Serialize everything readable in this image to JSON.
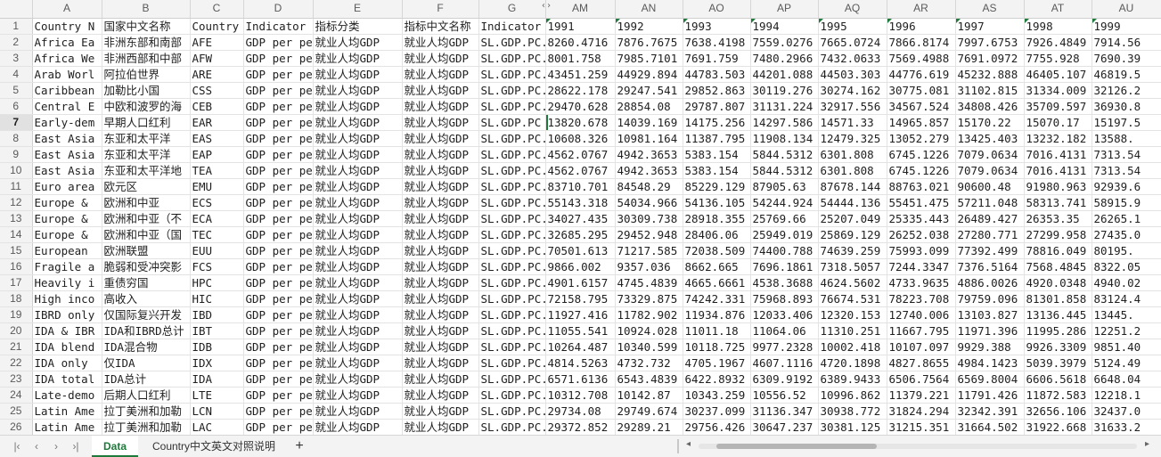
{
  "columns": [
    "",
    "A",
    "B",
    "C",
    "D",
    "E",
    "F",
    "G",
    "AM",
    "AN",
    "AO",
    "AP",
    "AQ",
    "AR",
    "AS",
    "AT",
    "AU"
  ],
  "header_row": {
    "num": "1",
    "cells": [
      "Country N",
      "国家中文名称",
      "Country",
      "Indicator",
      "指标分类",
      "指标中文名称",
      "Indicator",
      "1991",
      "1992",
      "1993",
      "1994",
      "1995",
      "1996",
      "1997",
      "1998",
      "1999"
    ]
  },
  "rows": [
    {
      "num": "2",
      "cells": [
        "Africa Ea",
        "非洲东部和南部",
        "AFE",
        "GDP per pe",
        "就业人均GDP",
        "就业人均GDP",
        "SL.GDP.PC.",
        "8260.4716",
        "7876.7675",
        "7638.4198",
        "7559.0276",
        "7665.0724",
        "7866.8174",
        "7997.6753",
        "7926.4849",
        "7914.56"
      ]
    },
    {
      "num": "3",
      "cells": [
        "Africa We",
        "非洲西部和中部",
        "AFW",
        "GDP per pe",
        "就业人均GDP",
        "就业人均GDP",
        "SL.GDP.PC.",
        "8001.758",
        "7985.7101",
        "7691.759",
        "7480.2966",
        "7432.0633",
        "7569.4988",
        "7691.0972",
        "7755.928",
        "7690.39"
      ]
    },
    {
      "num": "4",
      "cells": [
        "Arab Worl",
        "阿拉伯世界",
        "ARE",
        "GDP per pe",
        "就业人均GDP",
        "就业人均GDP",
        "SL.GDP.PC.",
        "43451.259",
        "44929.894",
        "44783.503",
        "44201.088",
        "44503.303",
        "44776.619",
        "45232.888",
        "46405.107",
        "46819.5"
      ]
    },
    {
      "num": "5",
      "cells": [
        "Caribbean",
        "加勒比小国",
        "CSS",
        "GDP per pe",
        "就业人均GDP",
        "就业人均GDP",
        "SL.GDP.PC.",
        "28622.178",
        "29247.541",
        "29852.863",
        "30119.276",
        "30274.162",
        "30775.081",
        "31102.815",
        "31334.009",
        "32126.2"
      ]
    },
    {
      "num": "6",
      "cells": [
        "Central E",
        "中欧和波罗的海",
        "CEB",
        "GDP per pe",
        "就业人均GDP",
        "就业人均GDP",
        "SL.GDP.PC.",
        "29470.628",
        "28854.08",
        "29787.807",
        "31131.224",
        "32917.556",
        "34567.524",
        "34808.426",
        "35709.597",
        "36930.8"
      ]
    },
    {
      "num": "7",
      "cells": [
        "Early-dem",
        "早期人口红利",
        "EAR",
        "GDP per pe",
        "就业人均GDP",
        "就业人均GDP",
        "SL.GDP.PC",
        "13820.678",
        "14039.169",
        "14175.256",
        "14297.586",
        "14571.33",
        "14965.857",
        "15170.22",
        "15070.17",
        "15197.5"
      ]
    },
    {
      "num": "8",
      "cells": [
        "East Asia",
        "东亚和太平洋",
        "EAS",
        "GDP per pe",
        "就业人均GDP",
        "就业人均GDP",
        "SL.GDP.PC.",
        "10608.326",
        "10981.164",
        "11387.795",
        "11908.134",
        "12479.325",
        "13052.279",
        "13425.403",
        "13232.182",
        "13588."
      ]
    },
    {
      "num": "9",
      "cells": [
        "East Asia",
        "东亚和太平洋",
        "EAP",
        "GDP per pe",
        "就业人均GDP",
        "就业人均GDP",
        "SL.GDP.PC.",
        "4562.0767",
        "4942.3653",
        "5383.154",
        "5844.5312",
        "6301.808",
        "6745.1226",
        "7079.0634",
        "7016.4131",
        "7313.54"
      ]
    },
    {
      "num": "10",
      "cells": [
        "East Asia",
        "东亚和太平洋地",
        "TEA",
        "GDP per pe",
        "就业人均GDP",
        "就业人均GDP",
        "SL.GDP.PC.",
        "4562.0767",
        "4942.3653",
        "5383.154",
        "5844.5312",
        "6301.808",
        "6745.1226",
        "7079.0634",
        "7016.4131",
        "7313.54"
      ]
    },
    {
      "num": "11",
      "cells": [
        "Euro area",
        "欧元区",
        "EMU",
        "GDP per pe",
        "就业人均GDP",
        "就业人均GDP",
        "SL.GDP.PC.",
        "83710.701",
        "84548.29",
        "85229.129",
        "87905.63",
        "87678.144",
        "88763.021",
        "90600.48",
        "91980.963",
        "92939.6"
      ]
    },
    {
      "num": "12",
      "cells": [
        "Europe &",
        "欧洲和中亚",
        "ECS",
        "GDP per pe",
        "就业人均GDP",
        "就业人均GDP",
        "SL.GDP.PC.",
        "55143.318",
        "54034.966",
        "54136.105",
        "54244.924",
        "54444.136",
        "55451.475",
        "57211.048",
        "58313.741",
        "58915.9"
      ]
    },
    {
      "num": "13",
      "cells": [
        "Europe &",
        "欧洲和中亚（不",
        "ECA",
        "GDP per pe",
        "就业人均GDP",
        "就业人均GDP",
        "SL.GDP.PC.",
        "34027.435",
        "30309.738",
        "28918.355",
        "25769.66",
        "25207.049",
        "25335.443",
        "26489.427",
        "26353.35",
        "26265.1"
      ]
    },
    {
      "num": "14",
      "cells": [
        "Europe &",
        "欧洲和中亚（国",
        "TEC",
        "GDP per pe",
        "就业人均GDP",
        "就业人均GDP",
        "SL.GDP.PC.",
        "32685.295",
        "29452.948",
        "28406.06",
        "25949.019",
        "25869.129",
        "26252.038",
        "27280.771",
        "27299.958",
        "27435.0"
      ]
    },
    {
      "num": "15",
      "cells": [
        "European",
        "欧洲联盟",
        "EUU",
        "GDP per pe",
        "就业人均GDP",
        "就业人均GDP",
        "SL.GDP.PC.",
        "70501.613",
        "71217.585",
        "72038.509",
        "74400.788",
        "74639.259",
        "75993.099",
        "77392.499",
        "78816.049",
        "80195."
      ]
    },
    {
      "num": "16",
      "cells": [
        "Fragile a",
        "脆弱和受冲突影",
        "FCS",
        "GDP per pe",
        "就业人均GDP",
        "就业人均GDP",
        "SL.GDP.PC.",
        "9866.002",
        "9357.036",
        "8662.665",
        "7696.1861",
        "7318.5057",
        "7244.3347",
        "7376.5164",
        "7568.4845",
        "8322.05"
      ]
    },
    {
      "num": "17",
      "cells": [
        "Heavily i",
        "重债穷国",
        "HPC",
        "GDP per pe",
        "就业人均GDP",
        "就业人均GDP",
        "SL.GDP.PC.",
        "4901.6157",
        "4745.4839",
        "4665.6661",
        "4538.3688",
        "4624.5602",
        "4733.9635",
        "4886.0026",
        "4920.0348",
        "4940.02"
      ]
    },
    {
      "num": "18",
      "cells": [
        "High inco",
        "高收入",
        "HIC",
        "GDP per pe",
        "就业人均GDP",
        "就业人均GDP",
        "SL.GDP.PC.",
        "72158.795",
        "73329.875",
        "74242.331",
        "75968.893",
        "76674.531",
        "78223.708",
        "79759.096",
        "81301.858",
        "83124.4"
      ]
    },
    {
      "num": "19",
      "cells": [
        "IBRD only",
        "仅国际复兴开发",
        "IBD",
        "GDP per pe",
        "就业人均GDP",
        "就业人均GDP",
        "SL.GDP.PC.",
        "11927.416",
        "11782.902",
        "11934.876",
        "12033.406",
        "12320.153",
        "12740.006",
        "13103.827",
        "13136.445",
        "13445."
      ]
    },
    {
      "num": "20",
      "cells": [
        "IDA & IBR",
        "IDA和IBRD总计",
        "IBT",
        "GDP per pe",
        "就业人均GDP",
        "就业人均GDP",
        "SL.GDP.PC.",
        "11055.541",
        "10924.028",
        "11011.18",
        "11064.06",
        "11310.251",
        "11667.795",
        "11971.396",
        "11995.286",
        "12251.2"
      ]
    },
    {
      "num": "21",
      "cells": [
        "IDA blend",
        "IDA混合物",
        "IDB",
        "GDP per pe",
        "就业人均GDP",
        "就业人均GDP",
        "SL.GDP.PC.",
        "10264.487",
        "10340.599",
        "10118.725",
        "9977.2328",
        "10002.418",
        "10107.097",
        "9929.388",
        "9926.3309",
        "9851.40"
      ]
    },
    {
      "num": "22",
      "cells": [
        "IDA only",
        "仅IDA",
        "IDX",
        "GDP per pe",
        "就业人均GDP",
        "就业人均GDP",
        "SL.GDP.PC.",
        "4814.5263",
        "4732.732",
        "4705.1967",
        "4607.1116",
        "4720.1898",
        "4827.8655",
        "4984.1423",
        "5039.3979",
        "5124.49"
      ]
    },
    {
      "num": "23",
      "cells": [
        "IDA total",
        "IDA总计",
        "IDA",
        "GDP per pe",
        "就业人均GDP",
        "就业人均GDP",
        "SL.GDP.PC.",
        "6571.6136",
        "6543.4839",
        "6422.8932",
        "6309.9192",
        "6389.9433",
        "6506.7564",
        "6569.8004",
        "6606.5618",
        "6648.04"
      ]
    },
    {
      "num": "24",
      "cells": [
        "Late-demo",
        "后期人口红利",
        "LTE",
        "GDP per pe",
        "就业人均GDP",
        "就业人均GDP",
        "SL.GDP.PC.",
        "10312.708",
        "10142.87",
        "10343.259",
        "10556.52",
        "10996.862",
        "11379.221",
        "11791.426",
        "11872.583",
        "12218.1"
      ]
    },
    {
      "num": "25",
      "cells": [
        "Latin Ame",
        "拉丁美洲和加勒",
        "LCN",
        "GDP per pe",
        "就业人均GDP",
        "就业人均GDP",
        "SL.GDP.PC.",
        "29734.08",
        "29749.674",
        "30237.099",
        "31136.347",
        "30938.772",
        "31824.294",
        "32342.391",
        "32656.106",
        "32437.0"
      ]
    },
    {
      "num": "26",
      "cells": [
        "Latin Ame",
        "拉丁美洲和加勒",
        "LAC",
        "GDP per pe",
        "就业人均GDP",
        "就业人均GDP",
        "SL.GDP.PC.",
        "29372.852",
        "29289.21",
        "29756.426",
        "30647.237",
        "30381.125",
        "31215.351",
        "31664.502",
        "31922.668",
        "31633.2"
      ]
    }
  ],
  "active_row": "7",
  "sheet_tabs": [
    "Data",
    "Country中文英文对照说明"
  ],
  "active_tab": "Data",
  "colors": {
    "accent": "#1e7a3a",
    "grid": "#e3e3e3",
    "header_bg": "#f3f3f3"
  }
}
